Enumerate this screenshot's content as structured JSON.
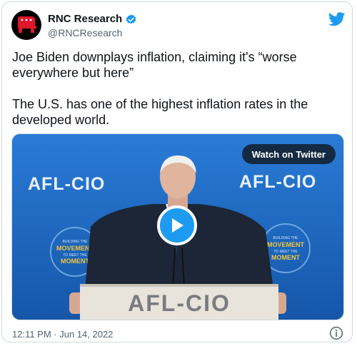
{
  "author": {
    "display_name": "RNC Research",
    "handle": "@RNCResearch"
  },
  "tweet": {
    "paragraphs": [
      "Joe Biden downplays inflation, claiming it's “worse everywhere but here”",
      "The U.S. has one of the highest inflation rates in the developed world."
    ]
  },
  "media": {
    "watch_label": "Watch on Twitter",
    "banner_left": "AFL-CIO",
    "banner_right": "AFL-CIO",
    "podium_text": "AFL-CIO",
    "emblem_lines": [
      "BUILDING THE",
      "MOVEMENT",
      "TO MEET THE",
      "MOMENT"
    ]
  },
  "timestamp": "12:11 PM · Jun 14, 2022",
  "colors": {
    "brand_blue": "#1d9bf0",
    "stage_blue": "#1d6fc9"
  },
  "icons": {
    "verified": "verified-badge-icon",
    "logo": "twitter-bird-icon",
    "play": "play-icon",
    "info": "info-icon"
  }
}
